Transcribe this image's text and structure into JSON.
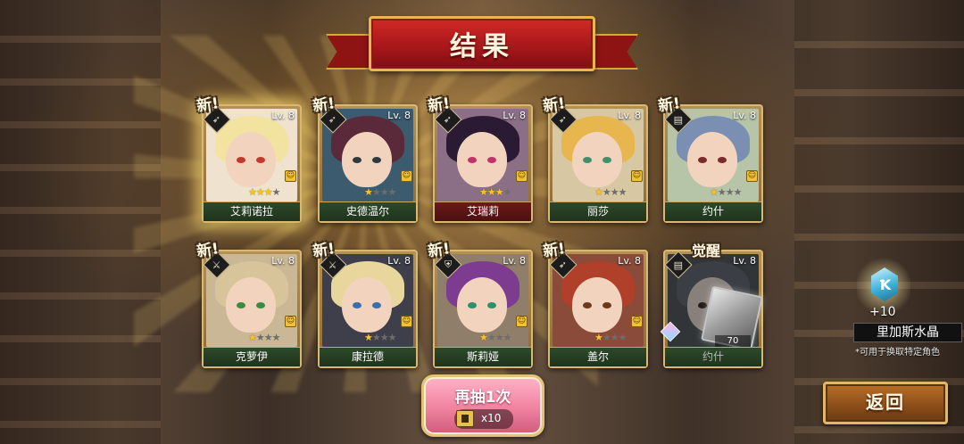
{
  "header": {
    "title": "结果"
  },
  "colors": {
    "banner_red": "#a5161a",
    "gold": "#e8b64c",
    "star_on": "#f6c52e",
    "namebar_green": "#2d4a2a"
  },
  "cards": [
    {
      "name": "艾莉诺拉",
      "level": "Lv. 8",
      "tag": "新!",
      "stars": 3,
      "class_icon": "bow-icon",
      "hair": "#f3e3a0",
      "eyes": "#c0392b",
      "bg": "#efe2cf"
    },
    {
      "name": "史德温尔",
      "level": "Lv. 8",
      "tag": "新!",
      "stars": 1,
      "class_icon": "bow-icon",
      "hair": "#5b2a3a",
      "eyes": "#2e3b3e",
      "bg": "#3d5b6f"
    },
    {
      "name": "艾瑞莉",
      "level": "Lv. 8",
      "tag": "新!",
      "stars": 3,
      "class_icon": "bow-icon",
      "hair": "#2a1a33",
      "eyes": "#c0326a",
      "bg": "#8b6f86"
    },
    {
      "name": "丽莎",
      "level": "Lv. 8",
      "tag": "新!",
      "stars": 1,
      "class_icon": "bow-icon",
      "hair": "#e7b64f",
      "eyes": "#3f8f6b",
      "bg": "#d8c7a3"
    },
    {
      "name": "约什",
      "level": "Lv. 8",
      "tag": "新!",
      "stars": 1,
      "class_icon": "book-icon",
      "hair": "#7a8fb2",
      "eyes": "#7a2a2a",
      "bg": "#b6c4a8"
    },
    {
      "name": "克萝伊",
      "level": "Lv. 8",
      "tag": "新!",
      "stars": 1,
      "class_icon": "sword-icon",
      "hair": "#d8c49a",
      "eyes": "#3c8a3f",
      "bg": "#c9b795"
    },
    {
      "name": "康拉德",
      "level": "Lv. 8",
      "tag": "新!",
      "stars": 1,
      "class_icon": "sword-icon",
      "hair": "#e9d69c",
      "eyes": "#3a6fa8",
      "bg": "#3f3f4c"
    },
    {
      "name": "斯莉娅",
      "level": "Lv. 8",
      "tag": "新!",
      "stars": 1,
      "class_icon": "shield-icon",
      "hair": "#7d3c8f",
      "eyes": "#2f8f6b",
      "bg": "#8f7f6a"
    },
    {
      "name": "盖尔",
      "level": "Lv. 8",
      "tag": "新!",
      "stars": 1,
      "class_icon": "bow-icon",
      "hair": "#b0402a",
      "eyes": "#6b3a1a",
      "bg": "#8a4b3a"
    },
    {
      "name": "约什",
      "level": "Lv. 8",
      "tag": "觉醒",
      "stars": 1,
      "class_icon": "book-icon",
      "hair": "#5a6a82",
      "eyes": "#4a2a2a",
      "bg": "#4b5a62",
      "dim": true,
      "shard_count": "70"
    }
  ],
  "reward": {
    "count": "+10",
    "name": "里加斯水晶",
    "desc": "*可用于换取特定角色",
    "icon_glyph": "Ꝁ"
  },
  "draw_again": {
    "label": "再抽1次",
    "cost": "x10"
  },
  "return_button": {
    "label": "返回"
  }
}
